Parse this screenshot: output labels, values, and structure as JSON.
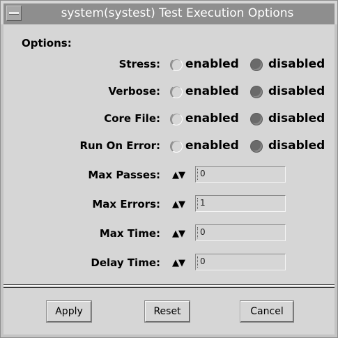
{
  "window": {
    "title": "system(systest) Test Execution Options"
  },
  "options": {
    "heading": "Options:",
    "enabled_label": "enabled",
    "disabled_label": "disabled",
    "toggles": [
      {
        "label": "Stress:",
        "value": "disabled"
      },
      {
        "label": "Verbose:",
        "value": "disabled"
      },
      {
        "label": "Core File:",
        "value": "disabled"
      },
      {
        "label": "Run On Error:",
        "value": "disabled"
      }
    ],
    "spin_glyph": "▲▼",
    "numeric": [
      {
        "label": "Max Passes:",
        "value": "0"
      },
      {
        "label": "Max Errors:",
        "value": "1"
      },
      {
        "label": "Max Time:",
        "value": "0"
      },
      {
        "label": "Delay Time:",
        "value": "0"
      }
    ]
  },
  "buttons": {
    "apply": "Apply",
    "reset": "Reset",
    "cancel": "Cancel"
  },
  "colors": {
    "background": "#d6d6d6",
    "titlebar": "#8e8e8e",
    "selected_radio": "#6a6a6a"
  }
}
